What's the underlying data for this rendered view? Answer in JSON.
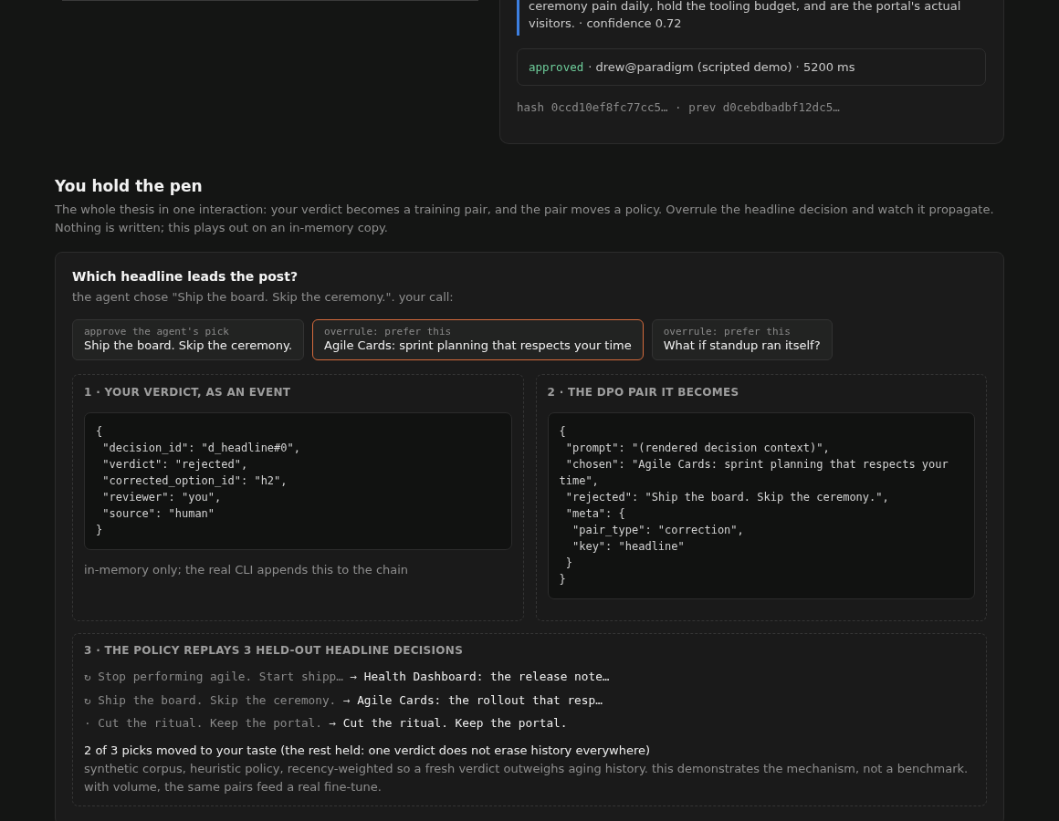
{
  "review": {
    "rationale": "ceremony pain daily, hold the tooling budget, and are the portal's actual visitors. · confidence 0.72",
    "status": "approved",
    "detail": "· drew@paradigm (scripted demo) · 5200 ms",
    "hash": "hash 0ccd10ef8fc77cc5… · prev d0cebdbadbf12dc5…"
  },
  "section": {
    "title": "You hold the pen",
    "description": "The whole thesis in one interaction: your verdict becomes a training pair, and the pair moves a policy. Overrule the headline decision and watch it propagate. Nothing is written; this plays out on an in-memory copy."
  },
  "decision": {
    "question": "Which headline leads the post?",
    "context": "the agent chose \"Ship the board. Skip the ceremony.\". your call:",
    "options": [
      {
        "label": "approve the agent's pick",
        "text": "Ship the board. Skip the ceremony.",
        "selected": false
      },
      {
        "label": "overrule: prefer this",
        "text": "Agile Cards: sprint planning that respects your time",
        "selected": true
      },
      {
        "label": "overrule: prefer this",
        "text": "What if standup ran itself?",
        "selected": false
      }
    ],
    "steps": [
      {
        "heading": "1 · YOUR VERDICT, AS AN EVENT",
        "code": "{\n \"decision_id\": \"d_headline#0\",\n \"verdict\": \"rejected\",\n \"corrected_option_id\": \"h2\",\n \"reviewer\": \"you\",\n \"source\": \"human\"\n}",
        "note": "in-memory only; the real CLI appends this to the chain"
      },
      {
        "heading": "2 · THE DPO PAIR IT BECOMES",
        "code": "{\n \"prompt\": \"(rendered decision context)\",\n \"chosen\": \"Agile Cards: sprint planning that respects your time\",\n \"rejected\": \"Ship the board. Skip the ceremony.\",\n \"meta\": {\n  \"pair_type\": \"correction\",\n  \"key\": \"headline\"\n }\n}"
      }
    ],
    "replay": {
      "heading": "3 · THE POLICY REPLAYS 3 HELD-OUT HEADLINE DECISIONS",
      "rows": [
        {
          "marker": "↻",
          "before": "Stop performing agile. Start shipp…",
          "arrow": "→",
          "after": "Health Dashboard: the release note…"
        },
        {
          "marker": "↻",
          "before": "Ship the board. Skip the ceremony.",
          "arrow": "→",
          "after": "Agile Cards: the rollout that resp…"
        },
        {
          "marker": "·",
          "before": "Cut the ritual. Keep the portal.",
          "arrow": "→",
          "after": "Cut the ritual. Keep the portal."
        }
      ],
      "summary": "2 of 3 picks moved to your taste (the rest held: one verdict does not erase history everywhere)",
      "caveat": "synthetic corpus, heuristic policy, recency-weighted so a fresh verdict outweighs aging history. this demonstrates the mechanism, not a benchmark. with volume, the same pairs feed a real fine-tune."
    }
  }
}
